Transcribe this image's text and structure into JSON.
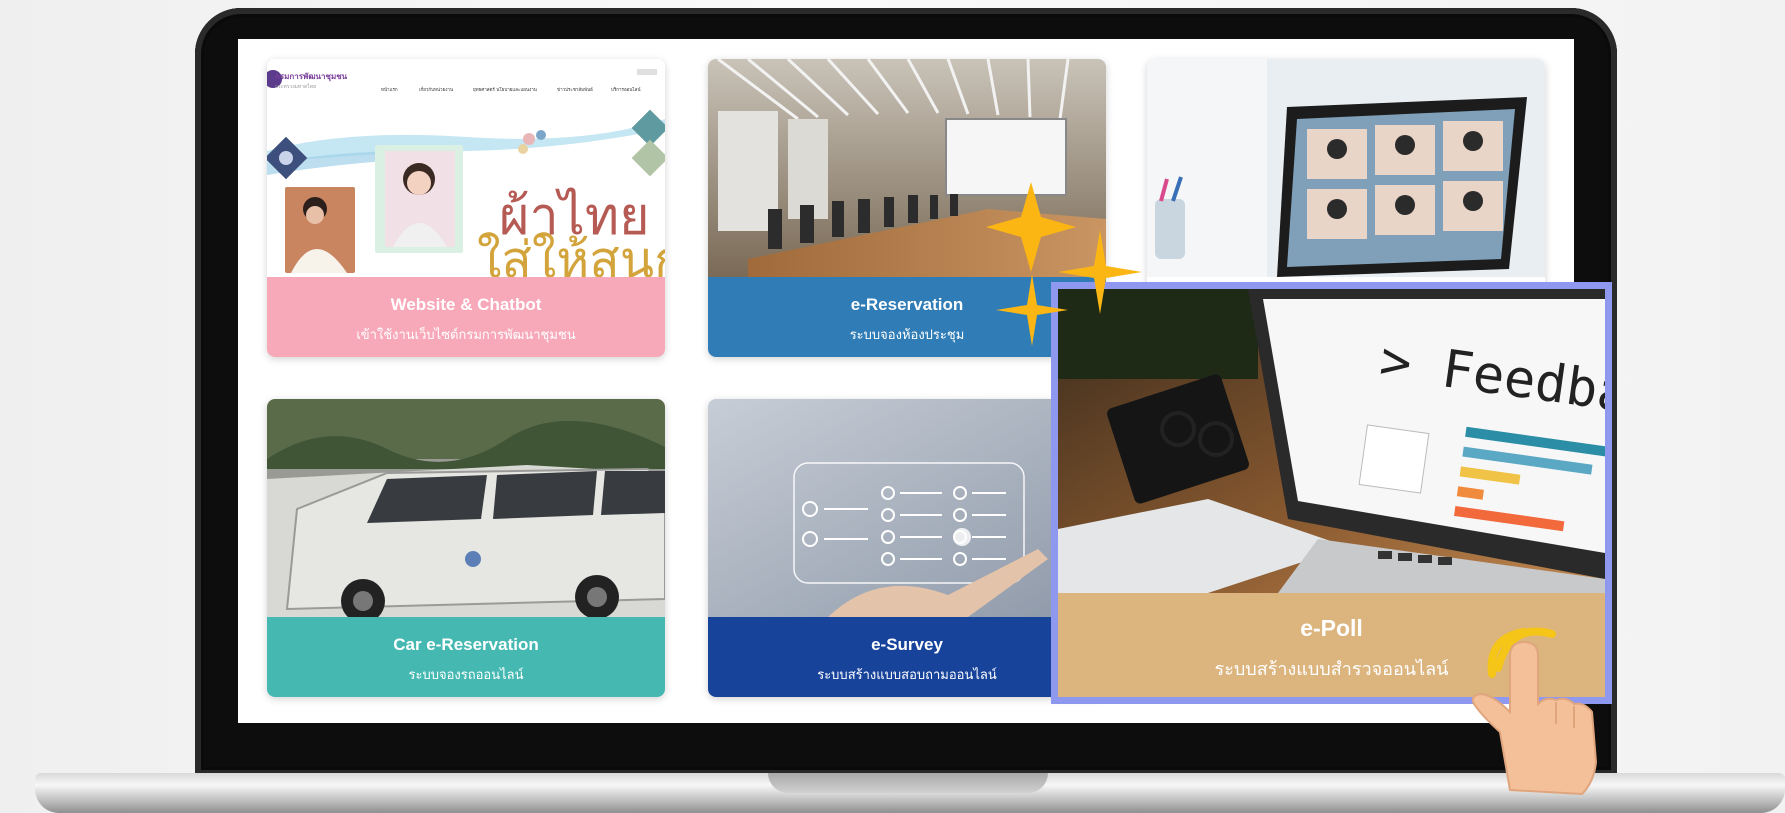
{
  "cards": [
    {
      "title": "Website & Chatbot",
      "subtitle": "เข้าใช้งานเว็บไซต์กรมการพัฒนาชุมชน",
      "color": "#f7a9b9"
    },
    {
      "title": "e-Reservation",
      "subtitle": "ระบบจองห้องประชุม",
      "color": "#2f7cb6"
    },
    {
      "title": "Car e-Reservation",
      "subtitle": "ระบบจองรถออนไลน์",
      "color": "#45b9b1"
    },
    {
      "title": "e-Survey",
      "subtitle": "ระบบสร้างแบบสอบถามออนไลน์",
      "color": "#17439b"
    },
    {
      "title": "e-Poll",
      "subtitle": "ระบบสร้างแบบสำรวจออนไลน์",
      "color": "#dcb47e"
    }
  ],
  "website_preview": {
    "org_name": "กรมการพัฒนาชุมชน",
    "org_sub": "กระทรวงมหาดไทย",
    "nav": [
      "หน้าแรก",
      "เกี่ยวกับหน่วยงาน",
      "ยุทธศาสตร์ นโยบายและแผนงาน",
      "ข่าวประชาสัมพันธ์",
      "บริการออนไลน์"
    ],
    "banner_line1": "ผ้าไทย",
    "banner_line2": "ใส่ให้สนุก"
  },
  "epoll_image_text": "> Feedbac",
  "icons": [
    "sparkle-icon",
    "pointing-hand-icon",
    "checkbox-icon"
  ],
  "highlight_color": "#8f98ef"
}
